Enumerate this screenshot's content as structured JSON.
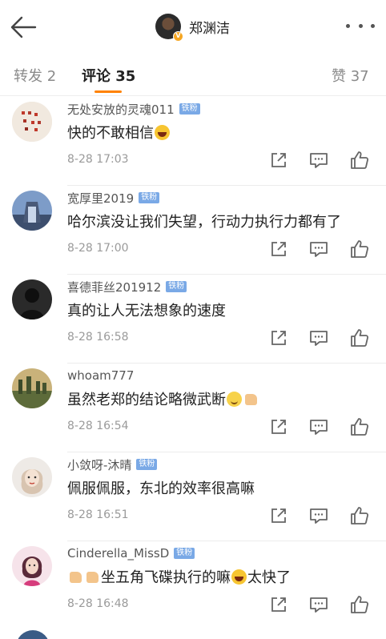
{
  "header": {
    "title": "郑渊洁",
    "back_icon": "arrow-left-icon",
    "more_icon": "more-dots-icon",
    "verified_badge": "V"
  },
  "tabs": [
    {
      "label": "转发 2"
    },
    {
      "label": "评论 35"
    },
    {
      "label": "赞 37"
    }
  ],
  "accent_color": "#ff8200",
  "fan_badge_label": "铁粉",
  "comments": [
    {
      "user": "无处安放的灵魂011",
      "text": "快的不敢相信",
      "time": "8-28 17:03"
    },
    {
      "user": "宽厚里2019",
      "text": "哈尔滨没让我们失望，行动力执行力都有了",
      "time": "8-28 17:00"
    },
    {
      "user": "喜德菲丝201912",
      "text": "真的让人无法想象的速度",
      "time": "8-28 16:58"
    },
    {
      "user": "whoam777",
      "text": "虽然老郑的结论略微武断",
      "time": "8-28 16:54"
    },
    {
      "user": "小敛呀-沐晴",
      "text": "佩服佩服，东北的效率很高嘛",
      "time": "8-28 16:51"
    },
    {
      "user": "Cinderella_MissD",
      "text_a": "坐五角飞碟执行的嘛",
      "text_b": "太快了",
      "time": "8-28 16:48"
    }
  ]
}
